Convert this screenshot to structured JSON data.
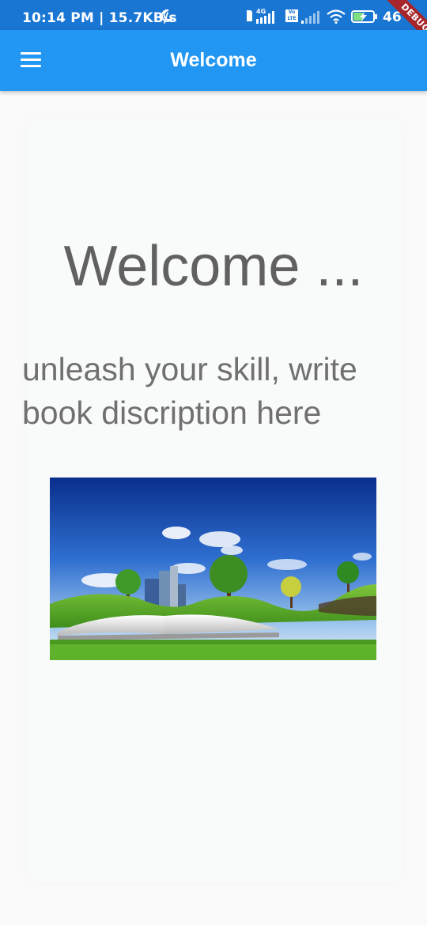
{
  "status_bar": {
    "time_speed": "10:14 PM | 15.7KB/s",
    "network_label": "4G",
    "volte_label": "Vo LTE",
    "battery_level": "46",
    "icons": [
      "moon-icon",
      "signal-icon",
      "volte-icon",
      "wifi-icon",
      "battery-charging-icon"
    ],
    "debug_banner": "DEBUG"
  },
  "app_bar": {
    "title": "Welcome",
    "menu_icon": "hamburger-menu-icon",
    "color": "#2196f3"
  },
  "content": {
    "heading": "Welcome ...",
    "description": "unleash your skill, write book discription here",
    "image_subject": "open book with green hills, trees and city skyline"
  }
}
